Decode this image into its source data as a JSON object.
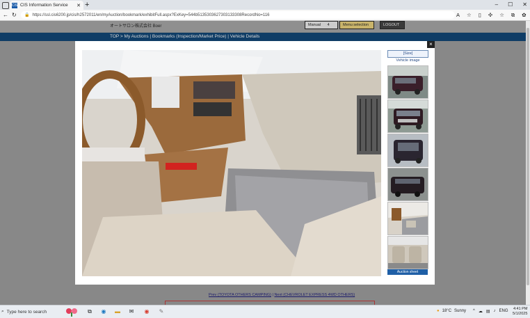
{
  "browser": {
    "tab_title": "CIS Information Service",
    "tab_favicon": "CIS",
    "new_tab": "+",
    "url": "https://ssl.cis6200.jp/cis/h2572011/en/myAuction/bookmark/exhibitFull.aspx?ExKey=544b5135303627303133308RecordNo=116",
    "reader_label": "A"
  },
  "page": {
    "company": "オートサロン株式会社   Boer",
    "buttons": [
      "Manual",
      "Menu selection",
      "LOGOUT"
    ],
    "button_manual_num": "4",
    "breadcrumb": "TOP > My Auctions | Bookmarks (Inspection/Market Price) | Vehicle Details",
    "prev_link": "Prev (TOYOTA OTHERS CAMPING)",
    "next_link": "Next (CHEVROLET EXPRESS 4WD OTHERS)"
  },
  "modal": {
    "close_label": "×",
    "size_label": "[Size]",
    "vehicle_image_label": "Vehicle image",
    "auction_sheet_label": "Auction sheet"
  },
  "taskbar": {
    "search_placeholder": "Type here to search",
    "temperature": "18°C",
    "weather": "Sunny",
    "language": "ENG",
    "time": "4:41 PM",
    "date": "5/1/2025"
  }
}
